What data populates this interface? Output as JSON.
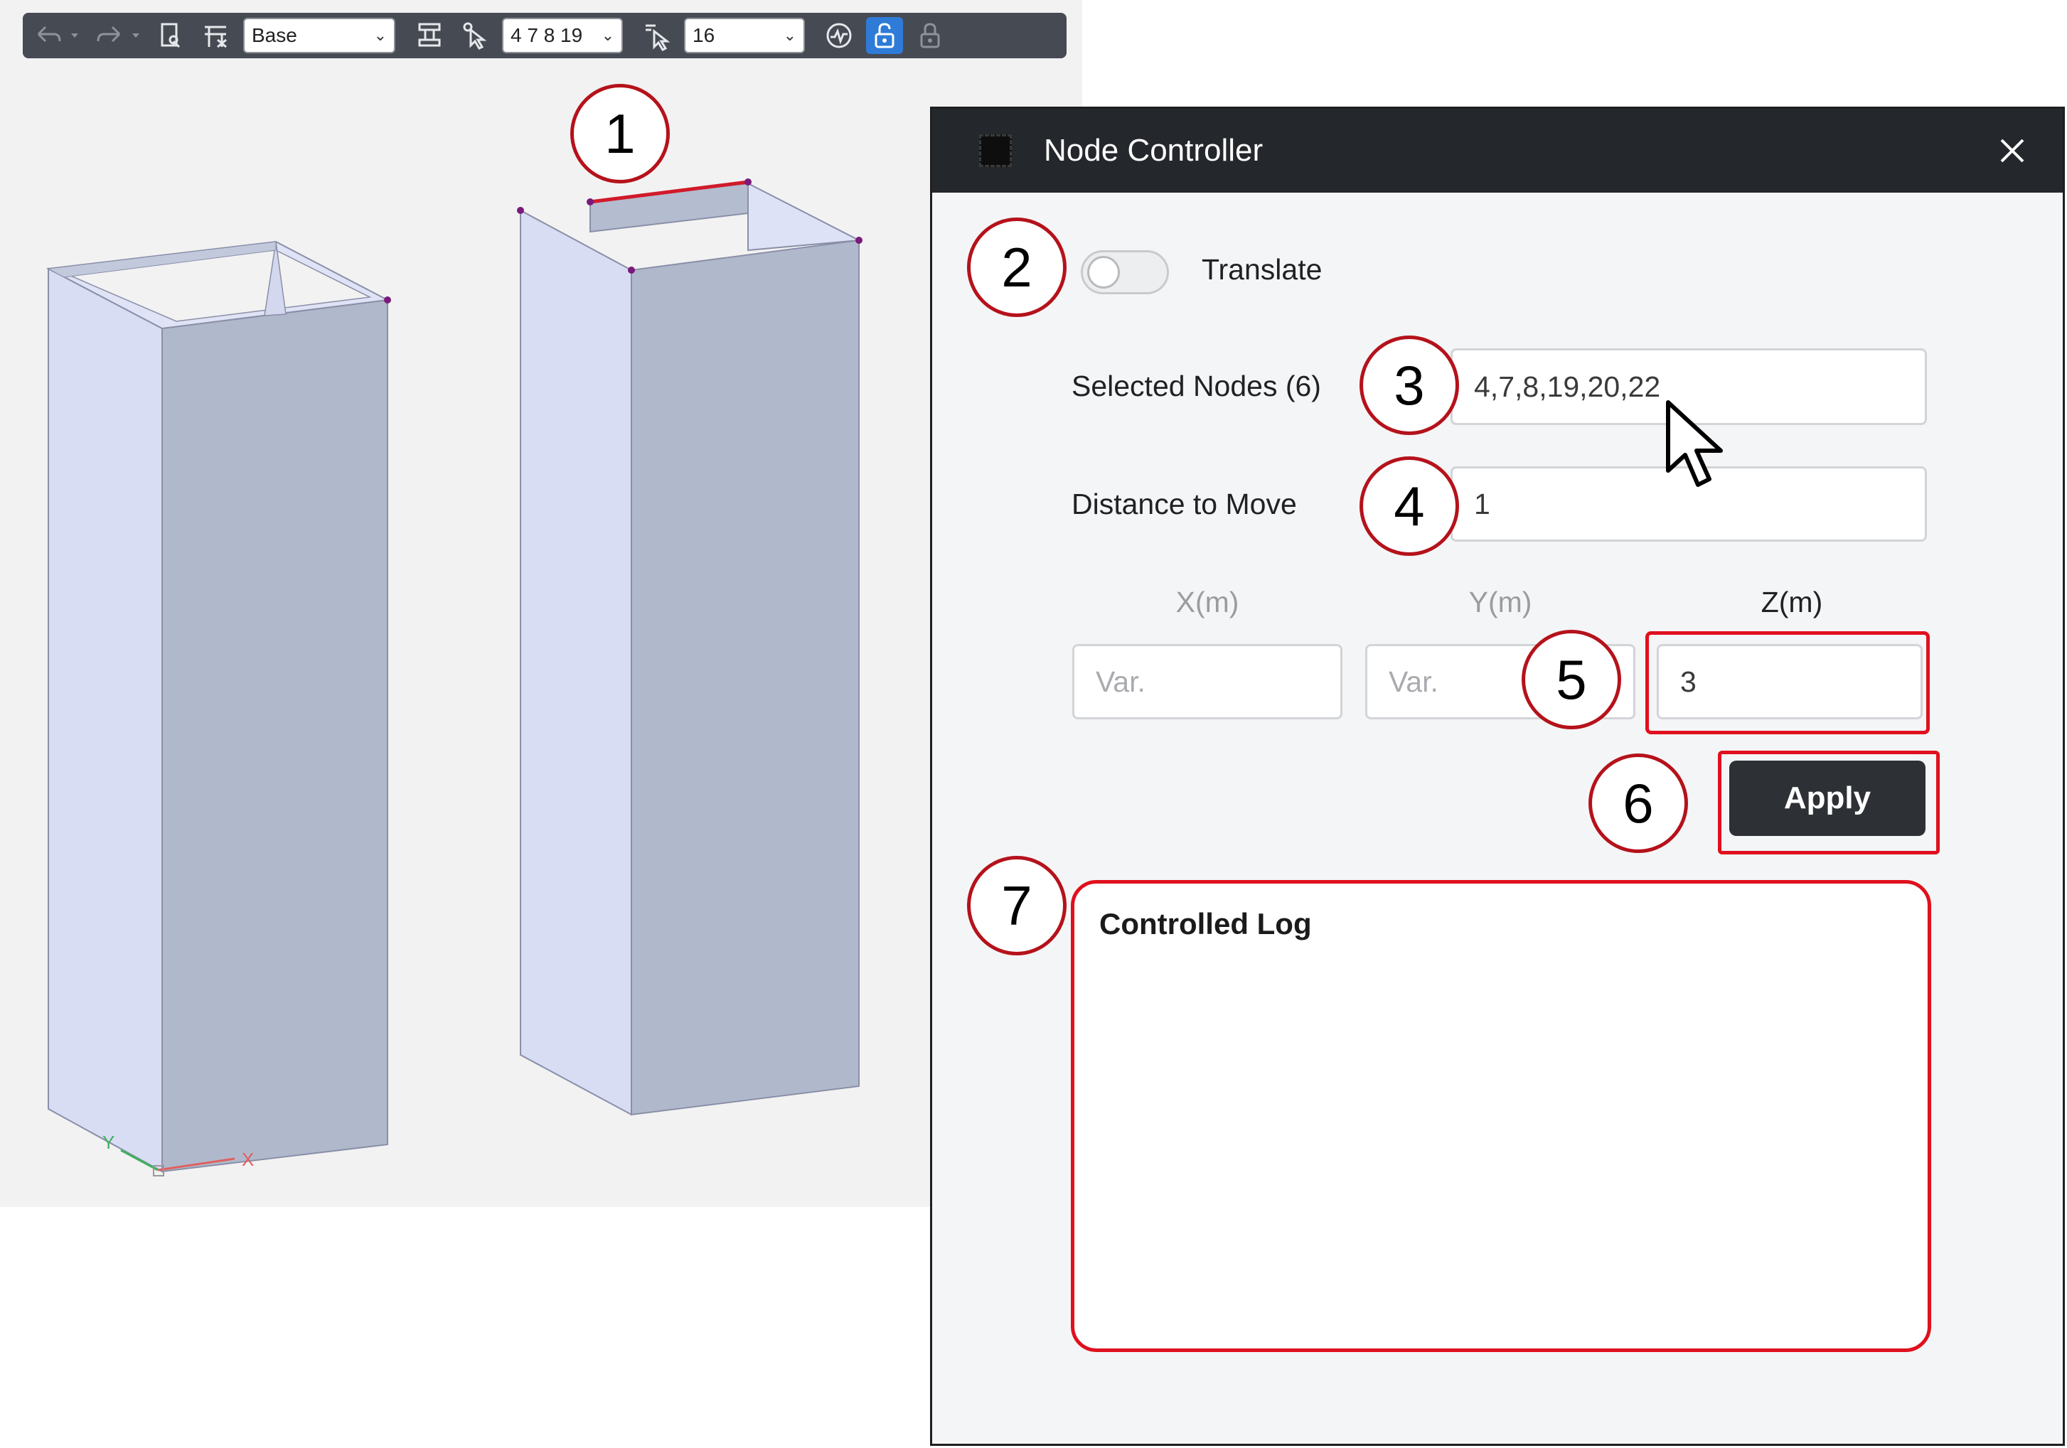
{
  "toolbar": {
    "icons": [
      "undo-icon",
      "redo-icon",
      "document-icon",
      "table-icon",
      "structure-icon",
      "select-cursor-icon",
      "filter-cursor-icon",
      "chart-icon",
      "unlock-icon",
      "lock-icon"
    ],
    "base_select": "Base",
    "nodes_select": "4 7 8 19",
    "number_select": "16",
    "accent_color": "#2e7bd8"
  },
  "viewport": {
    "axis_x": "X",
    "axis_y": "Y",
    "highlight_color": "#e0101e"
  },
  "dialog": {
    "title": "Node Controller",
    "translate_label": "Translate",
    "translate_on": false,
    "selected_nodes_label": "Selected Nodes (6)",
    "selected_nodes_value": "4,7,8,19,20,22",
    "distance_label": "Distance to Move",
    "distance_value": "1",
    "x_label": "X(m)",
    "y_label": "Y(m)",
    "z_label": "Z(m)",
    "x_placeholder": "Var.",
    "y_placeholder": "Var.",
    "z_value": "3",
    "apply_label": "Apply",
    "log_title": "Controlled Log"
  },
  "callouts": {
    "c1": "1",
    "c2": "2",
    "c3": "3",
    "c4": "4",
    "c5": "5",
    "c6": "6",
    "c7": "7"
  }
}
